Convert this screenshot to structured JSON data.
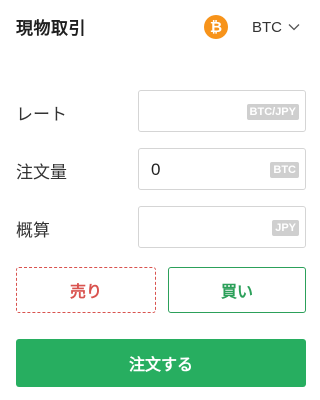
{
  "header": {
    "title": "現物取引",
    "coin_icon": "bitcoin-icon",
    "coin_symbol": "₿",
    "currency": "BTC",
    "dropdown_icon": "chevron-down-icon"
  },
  "form": {
    "rate": {
      "label": "レート",
      "value": "",
      "unit": "BTC/JPY"
    },
    "amount": {
      "label": "注文量",
      "value": "0",
      "unit": "BTC"
    },
    "estimate": {
      "label": "概算",
      "value": "",
      "unit": "JPY"
    }
  },
  "actions": {
    "sell_label": "売り",
    "buy_label": "買い",
    "order_label": "注文する"
  },
  "colors": {
    "bitcoin": "#f7931a",
    "sell": "#d9534f",
    "buy": "#2ca05a",
    "order": "#27ae60",
    "badge": "#cfcfcf"
  }
}
